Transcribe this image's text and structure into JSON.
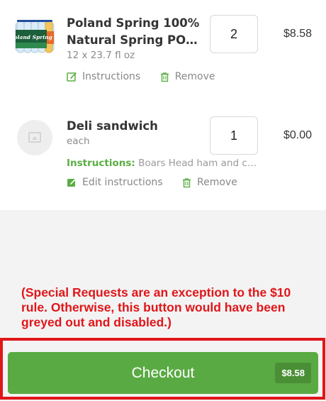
{
  "items": [
    {
      "name_line1": "Poland Spring 100%",
      "name_line2": "Natural Spring POLAND SPRING",
      "size": "12 x 23.7 fl oz",
      "quantity": "2",
      "price": "$8.58",
      "instructions_action": "Instructions",
      "remove_action": "Remove",
      "image_label": "Poland Spring",
      "image_icon": "water-bottle-pack"
    },
    {
      "name": "Deli sandwich",
      "size": "each",
      "quantity": "1",
      "price": "$0.00",
      "instructions_label": "Instructions:",
      "instructions_text": "Boars Head ham and cheese",
      "instructions_action": "Edit instructions",
      "remove_action": "Remove",
      "image_icon": "image-placeholder-icon"
    }
  ],
  "annotation": "(Special Requests are an exception to the $10 rule. Otherwise, this button would have been greyed out and disabled.)",
  "checkout": {
    "label": "Checkout",
    "total": "$8.58"
  },
  "colors": {
    "accent_green": "#5aaa43",
    "annotation_red": "#e0161a",
    "background": "#f3f3f3"
  }
}
